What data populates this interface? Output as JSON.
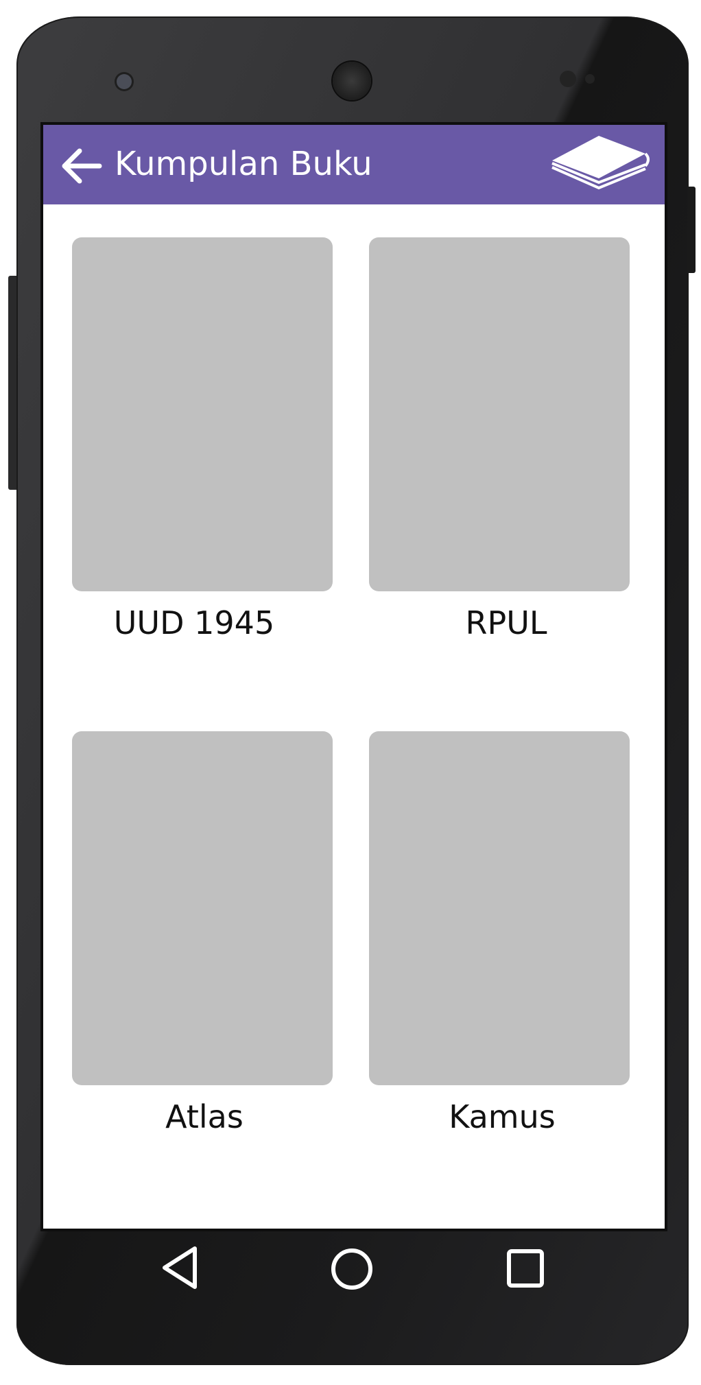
{
  "app_bar": {
    "title": "Kumpulan Buku",
    "back_icon": "arrow-left-icon",
    "logo_icon": "book-icon",
    "color": "#6959a6"
  },
  "books": [
    {
      "label": "UUD 1945"
    },
    {
      "label": "RPUL"
    },
    {
      "label": "Atlas"
    },
    {
      "label": "Kamus"
    }
  ],
  "navigation_bar": {
    "icons": [
      "triangle-back-icon",
      "circle-home-icon",
      "square-recents-icon"
    ]
  },
  "colors": {
    "placeholder": "#c0c0c0",
    "screen_background": "#ffffff",
    "device_body": "#2e2e30"
  }
}
